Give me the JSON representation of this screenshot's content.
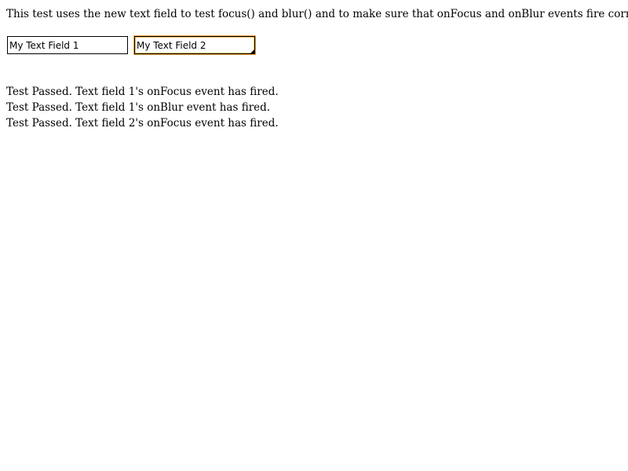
{
  "intro": {
    "text": "This test uses the new text field to test focus() and blur() and to make sure that onFocus and onBlur events fire correctly."
  },
  "fields": [
    {
      "value": "My Text Field 1",
      "focused": false
    },
    {
      "value": "My Text Field 2",
      "focused": true
    }
  ],
  "results": [
    "Test Passed. Text field 1's onFocus event has fired.",
    "Test Passed. Text field 1's onBlur event has fired.",
    "Test Passed. Text field 2's onFocus event has fired."
  ],
  "colors": {
    "focus_ring": "#e8a33a",
    "text": "#000000",
    "background": "#ffffff"
  }
}
